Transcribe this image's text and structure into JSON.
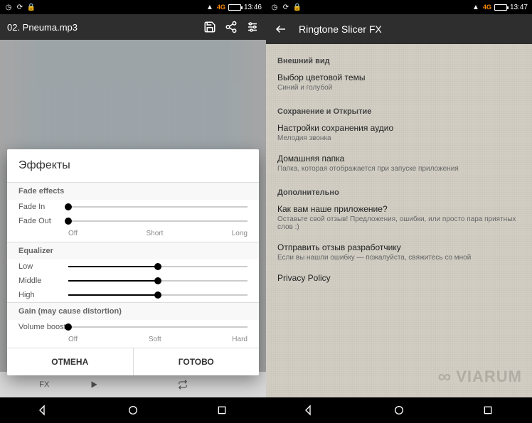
{
  "left": {
    "statusbar": {
      "time": "13:46",
      "net": "4G"
    },
    "toolbar": {
      "title": "02. Pneuma.mp3"
    },
    "bottomTools": {
      "fx": "FX"
    },
    "dialog": {
      "title": "Эффекты",
      "fade": {
        "header": "Fade effects",
        "in": "Fade In",
        "out": "Fade Out",
        "ticks": {
          "off": "Off",
          "short": "Short",
          "long": "Long"
        }
      },
      "eq": {
        "header": "Equalizer",
        "low": "Low",
        "mid": "Middle",
        "high": "High"
      },
      "gain": {
        "header": "Gain (may cause distortion)",
        "vol": "Volume boost",
        "ticks": {
          "off": "Off",
          "soft": "Soft",
          "hard": "Hard"
        }
      },
      "actions": {
        "cancel": "ОТМЕНА",
        "ok": "ГОТОВО"
      }
    }
  },
  "right": {
    "statusbar": {
      "time": "13:47",
      "net": "4G"
    },
    "toolbar": {
      "title": "Ringtone Slicer FX"
    },
    "sections": {
      "appearance": {
        "header": "Внешний вид",
        "theme": {
          "p": "Выбор цветовой темы",
          "s": "Синий и голубой"
        }
      },
      "saveopen": {
        "header": "Сохранение и Открытие",
        "save": {
          "p": "Настройки сохранения аудио",
          "s": "Мелодия звонка"
        },
        "home": {
          "p": "Домашняя папка",
          "s": "Папка, которая отображается при запуске приложения"
        }
      },
      "extra": {
        "header": "Дополнительно",
        "rate": {
          "p": "Как вам наше приложение?",
          "s": "Оставьте свой отзыв! Предложения, ошибки, или просто пара приятных слов :)"
        },
        "feedback": {
          "p": "Отправить отзыв разработчику",
          "s": "Если вы нашли ошибку — пожалуйста, свяжитесь со мной"
        },
        "privacy": {
          "p": "Privacy Policy"
        }
      }
    },
    "watermark": "VIARUM"
  }
}
